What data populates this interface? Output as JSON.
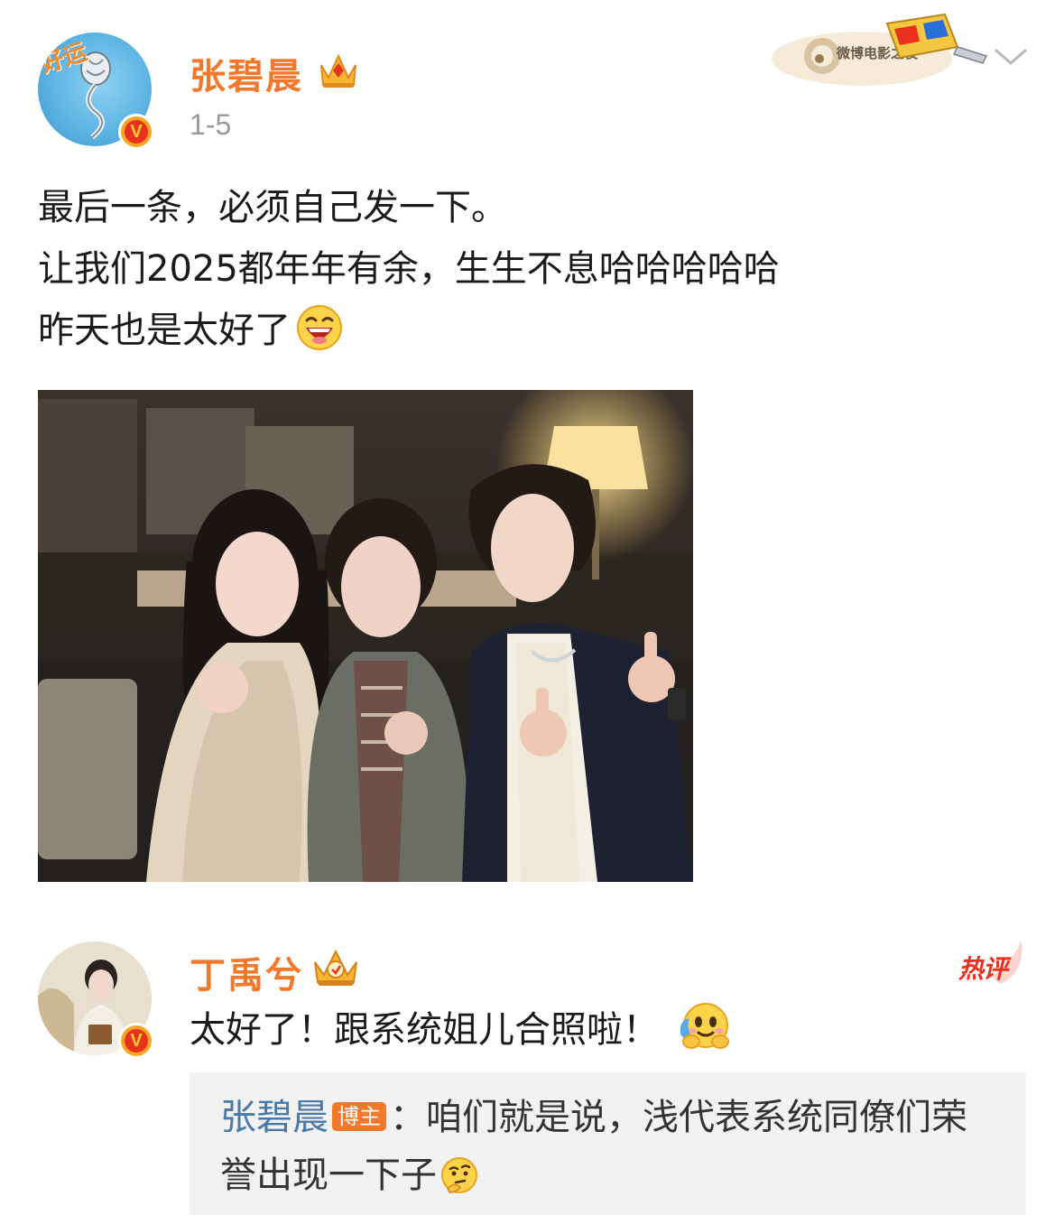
{
  "post": {
    "author": "张碧晨",
    "time": "1-5",
    "avatar_overlay": "好运",
    "verified_icon": "v-badge-icon",
    "member_icon": "crown-icon",
    "event_banner_label": "微博电影之夜",
    "lines": [
      "最后一条，必须自己发一下。",
      "让我们2025都年年有余，生生不息哈哈哈哈哈",
      "昨天也是太好了"
    ],
    "trailing_emoji": "grin-emoji",
    "photo": "photo-three-people"
  },
  "comment": {
    "author": "丁禹兮",
    "hot_label": "热评",
    "text": "太好了！跟系统姐儿合照啦！",
    "trailing_emoji": "hug-emoji",
    "reply": {
      "author": "张碧晨",
      "op_tag": "博主",
      "separator": "：",
      "line1": "咱们就是说，浅代表系统同僚们荣",
      "line2": "誉出现一下子",
      "trailing_emoji": "thinking-emoji"
    }
  },
  "colors": {
    "name_orange": "#f2792b",
    "reply_blue": "#4a78a8",
    "hot_red": "#e8321f",
    "reply_bg": "#f2f2f2"
  }
}
